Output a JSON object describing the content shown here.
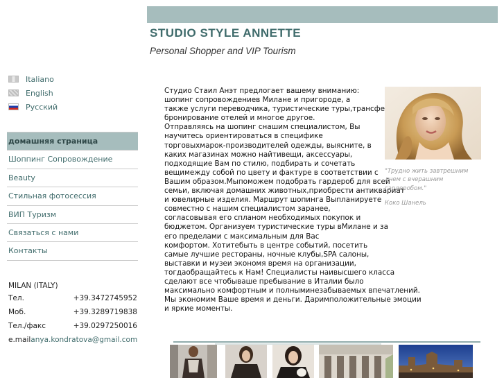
{
  "header": {
    "title": "STUDIO STYLE ANNETTE",
    "subtitle": "Personal Shopper and VIP Tourism"
  },
  "languages": [
    {
      "label": "Italiano",
      "flag": "flag-it"
    },
    {
      "label": "English",
      "flag": "flag-en"
    },
    {
      "label": "Русский",
      "flag": "flag-ru"
    }
  ],
  "nav": {
    "items": [
      {
        "label": "домашняя страница",
        "active": true
      },
      {
        "label": "Шоппинг Сопровождение"
      },
      {
        "label": "Beauty"
      },
      {
        "label": "Стильная фотосессия"
      },
      {
        "label": "ВИП Туризм"
      },
      {
        "label": "Связаться с нами"
      },
      {
        "label": "Контакты"
      }
    ]
  },
  "contacts": {
    "city": "MILAN (ITALY)",
    "phone_label": "Тел.",
    "phone": "+39.3472745952",
    "mobile_label": "Моб.",
    "mobile": "+39.3289719838",
    "fax_label": "Тел./факс",
    "fax": "+39.0297250016",
    "email_label": "e.mail",
    "email": "anya.kondratova@gmail.com"
  },
  "main": {
    "body_text": "Студио Стаил Анэт предлогает вашему вниманию:\nшопинг сопровождениев Милане и пригороде, а\nтакже услуги переводчика, туристические туры,трансфе\nбронирование отелей и многое другое.\nОтправляясь на шопинг снашим специалистом, Вы\nнаучитесь ориентироваться в специфике\nторговыхмарок-производителей одежды, выясните, в\nкаких магазинах можно найтивещи, аксессуары,\nподходящие Вам по стилю, подбирать и сочетать\nвещимежду собой по цвету и фактуре в соответствии с\nВашим образом.Мыпоможем подобрать гардероб для всей\nсемьи, включая домашних животных,приобрести антиквариат\nи ювелирные изделия. Маршрут шопинга Выпланируете\nсовместно с нашим специалистом заранее,\nсогласовывая его спланом необходимых покупок и\nбюджетом. Организуем туристические туры вМилане и за\nего пределами с максимальным для Вас\nкомфортом. Хотитебыть в центре событий, посетить\nсамые лучшие рестораны, ночные клубы,SPA салоны,\nвыставки и музеи экономя время на организации,\nтогдаобращайтесь к Нам! Специалисты наивысшего класса\nсделают все чтобываше пребывание в Италии было\nмаксимально комфортным и полныминезабываемых впечатлений.\nМы экономим Ваше время и деньги. Даримположительные эмоции\nи яркие моменты."
  },
  "quote": {
    "text": "\"Трудно жить завтрешним днем с вчерашним гардеробом.\"",
    "author": "Коко Шанель"
  },
  "colors": {
    "accent": "#a6bdbd",
    "link": "#3f6b6b"
  }
}
